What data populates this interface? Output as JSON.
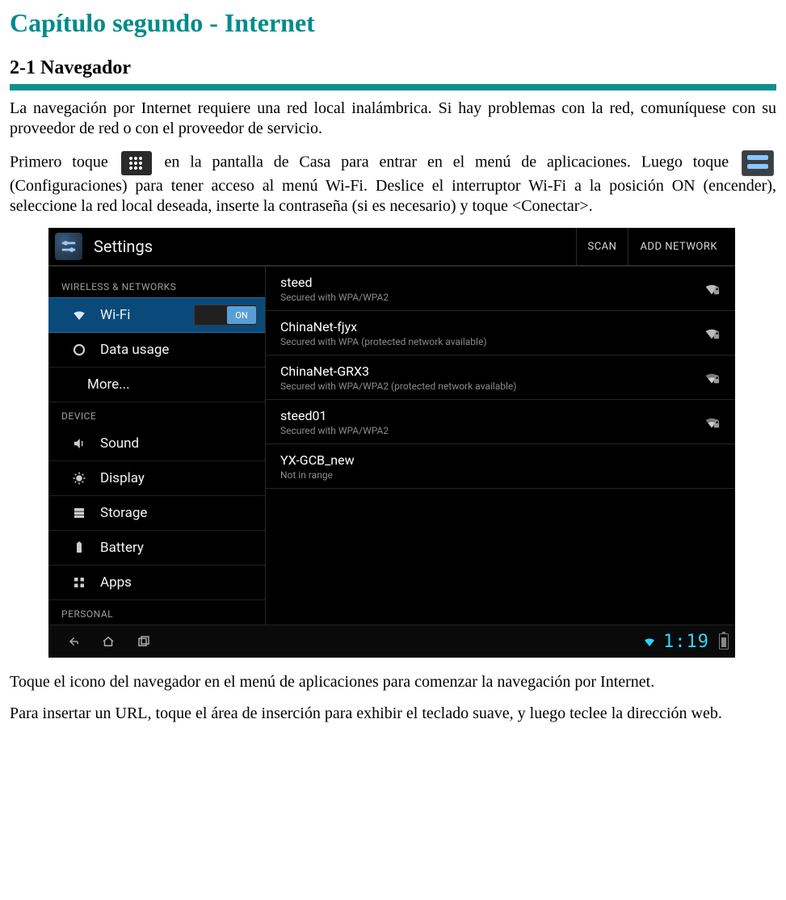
{
  "chapter_title": "Capítulo segundo - Internet",
  "section_title": "2-1 Navegador",
  "para1": "La navegación por Internet requiere una red local inalámbrica. Si hay problemas con la red, comuníquese con su proveedor de red o con el proveedor de servicio.",
  "para2_a": "Primero toque ",
  "para2_b": " en la pantalla de Casa para entrar en el menú de aplicaciones.   Luego toque ",
  "para2_c": " (Configuraciones) para tener acceso al menú Wi-Fi.  Deslice el interruptor Wi-Fi a la posición ON (encender), seleccione la red local deseada, inserte la contraseña (si es necesario) y toque <Conectar>.",
  "para3": "Toque el icono del navegador en el menú de  aplicaciones para comenzar la navegación por Internet.",
  "para4": "Para insertar un URL, toque el área de inserción para exhibir el teclado suave, y luego teclee la dirección web.",
  "screenshot": {
    "title": "Settings",
    "buttons": {
      "scan": "SCAN",
      "add": "ADD NETWORK"
    },
    "sidebar": {
      "cat1": "WIRELESS & NETWORKS",
      "wifi": "Wi-Fi",
      "wifi_toggle": "ON",
      "data_usage": "Data usage",
      "more": "More...",
      "cat2": "DEVICE",
      "sound": "Sound",
      "display": "Display",
      "storage": "Storage",
      "battery": "Battery",
      "apps": "Apps",
      "cat3": "PERSONAL"
    },
    "networks": [
      {
        "ssid": "steed",
        "sub": "Secured with WPA/WPA2",
        "strength": 3,
        "lock": true
      },
      {
        "ssid": "ChinaNet-fjyx",
        "sub": "Secured with WPA (protected network available)",
        "strength": 3,
        "lock": true
      },
      {
        "ssid": "ChinaNet-GRX3",
        "sub": "Secured with WPA/WPA2 (protected network available)",
        "strength": 2,
        "lock": true
      },
      {
        "ssid": "steed01",
        "sub": "Secured with WPA/WPA2",
        "strength": 2,
        "lock": true
      },
      {
        "ssid": "YX-GCB_new",
        "sub": "Not in range",
        "strength": 0,
        "lock": false
      }
    ],
    "clock": "1:19"
  }
}
